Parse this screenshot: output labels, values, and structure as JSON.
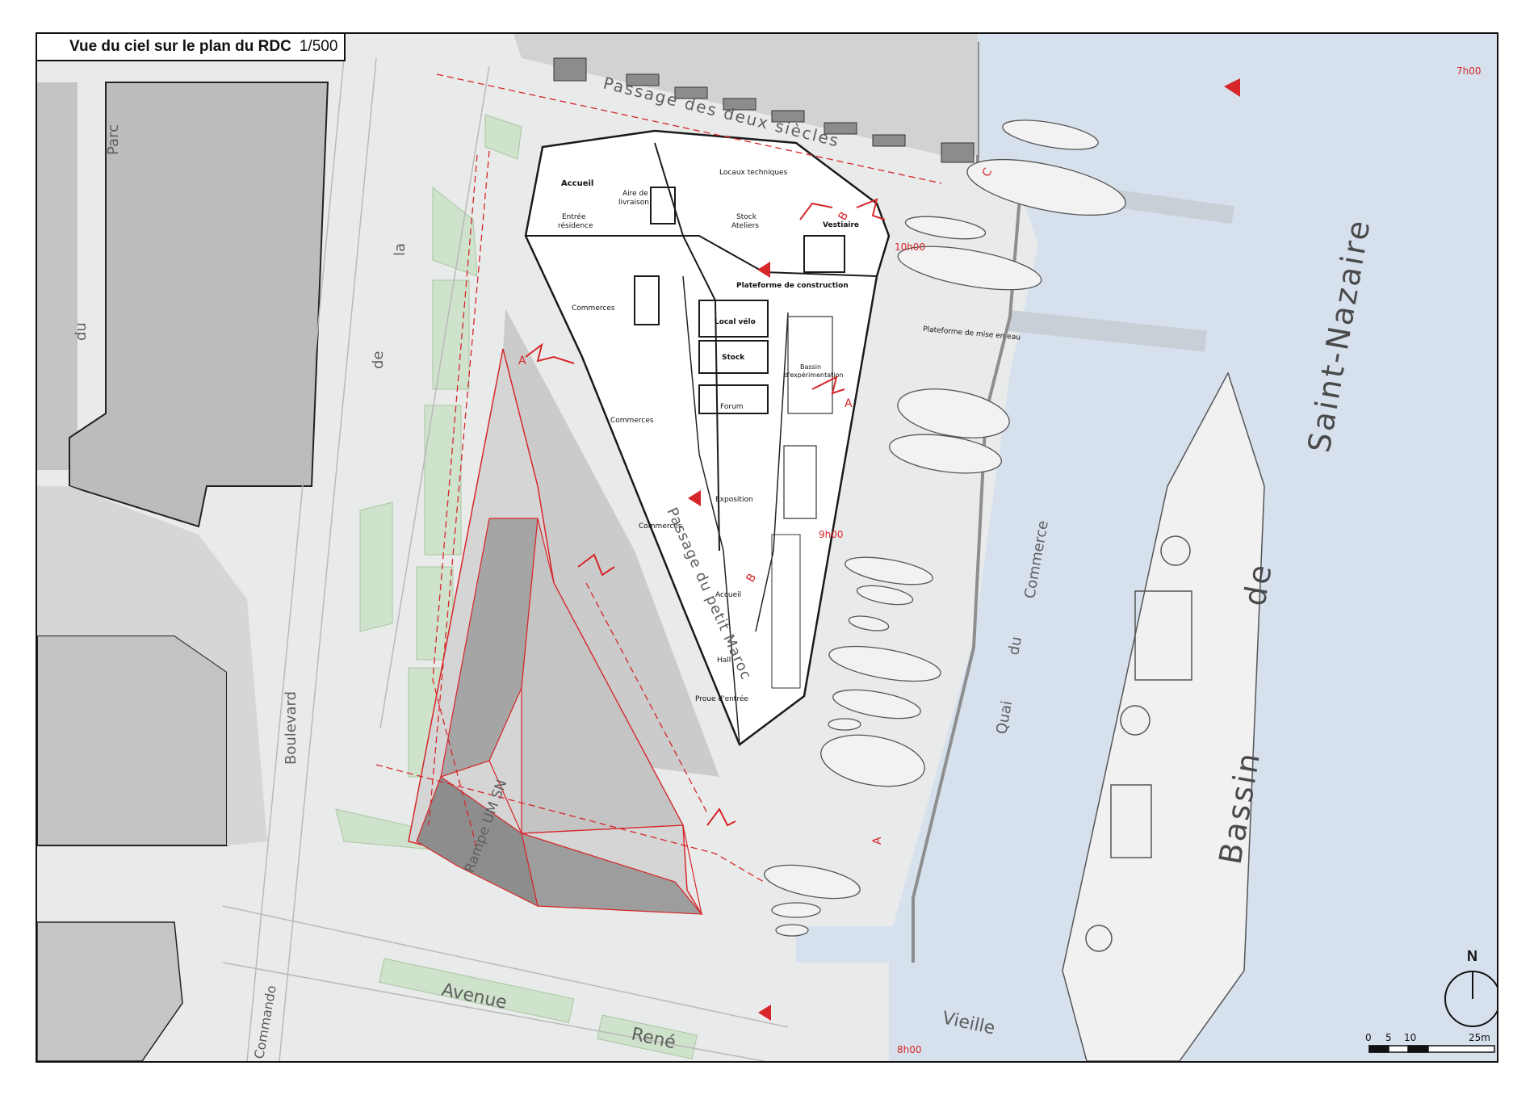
{
  "title": {
    "text": "Vue du ciel sur le plan du RDC",
    "scale": "1/500"
  },
  "rooms": {
    "accueil_residence": "Accueil",
    "aire_livraison_1": "Aire de",
    "aire_livraison_2": "livraison",
    "entree_residence_1": "Entrée",
    "entree_residence_2": "résidence",
    "locaux_techniques": "Locaux techniques",
    "stock_ateliers_1": "Stock",
    "stock_ateliers_2": "Ateliers",
    "vestiaire": "Vestiaire",
    "plateforme_construction": "Plateforme de construction",
    "local_velo": "Local vélo",
    "stock": "Stock",
    "commerces_1": "Commerces",
    "commerces_2": "Commerces",
    "commerces_3": "Commerces",
    "bassin_exp_1": "Bassin",
    "bassin_exp_2": "d'expérimentation",
    "forum": "Forum",
    "exposition": "Exposition",
    "accueil": "Accueil",
    "hall": "Hall",
    "proue": "Proue d'entrée",
    "plateforme_mise_eau": "Plateforme de mise en eau"
  },
  "streets": {
    "passage_deux_siecles": "Passage des deux siècles",
    "boulevard": "Boulevard",
    "de": "de",
    "la": "la",
    "parc": "Parc",
    "du": "du",
    "passage_petit_maroc": "Passage du petit Maroc",
    "rampe": "Rampe UM SN",
    "quai": "Quai",
    "quai_du": "du",
    "commerce": "Commerce",
    "avenue": "Avenue",
    "rene": "René",
    "vieille": "Vieille",
    "commando": "Commando",
    "bassin": "Bassin",
    "bassin_de": "de",
    "saint_nazaire": "Saint-Nazaire"
  },
  "section_marks": {
    "a": "A",
    "b": "B",
    "c": "C"
  },
  "sun_times": {
    "t7": "7h00",
    "t8": "8h00",
    "t9": "9h00",
    "t10": "10h00"
  },
  "north": "N",
  "scale_bar": {
    "ticks": [
      "0",
      "5",
      "10",
      "25m"
    ]
  },
  "colors": {
    "ground": "#e9ebea",
    "water": "#d7e1ee",
    "greenery": "#cfe2cb",
    "building": "#bdbdbd",
    "section_red": "#d6262a",
    "triangle_fill": "#9a9a9a"
  }
}
